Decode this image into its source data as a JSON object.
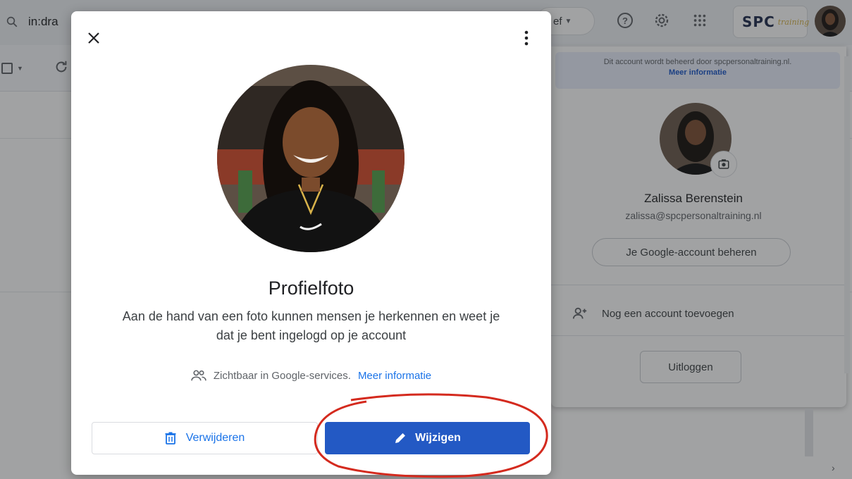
{
  "background": {
    "search_text": "in:dra",
    "filter_chip_label": "ef",
    "brand_text": "SPC",
    "brand_sub": "training"
  },
  "account_panel": {
    "managed_text": "Dit account wordt beheerd door spcpersonaltraining.nl.",
    "managed_link": "Meer informatie",
    "name": "Zalissa Berenstein",
    "email": "zalissa@spcpersonaltraining.nl",
    "manage_button": "Je Google-account beheren",
    "add_account": "Nog een account toevoegen",
    "logout": "Uitloggen"
  },
  "dialog": {
    "title": "Profielfoto",
    "description": "Aan de hand van een foto kunnen mensen je herkennen en weet je dat je bent ingelogd op je account",
    "visibility_text": "Zichtbaar in Google-services.",
    "visibility_link": "Meer informatie",
    "remove_button": "Verwijderen",
    "edit_button": "Wijzigen"
  },
  "colors": {
    "primary_button": "#2359c4",
    "link": "#1a73e8",
    "annotation": "#d42a1e"
  }
}
